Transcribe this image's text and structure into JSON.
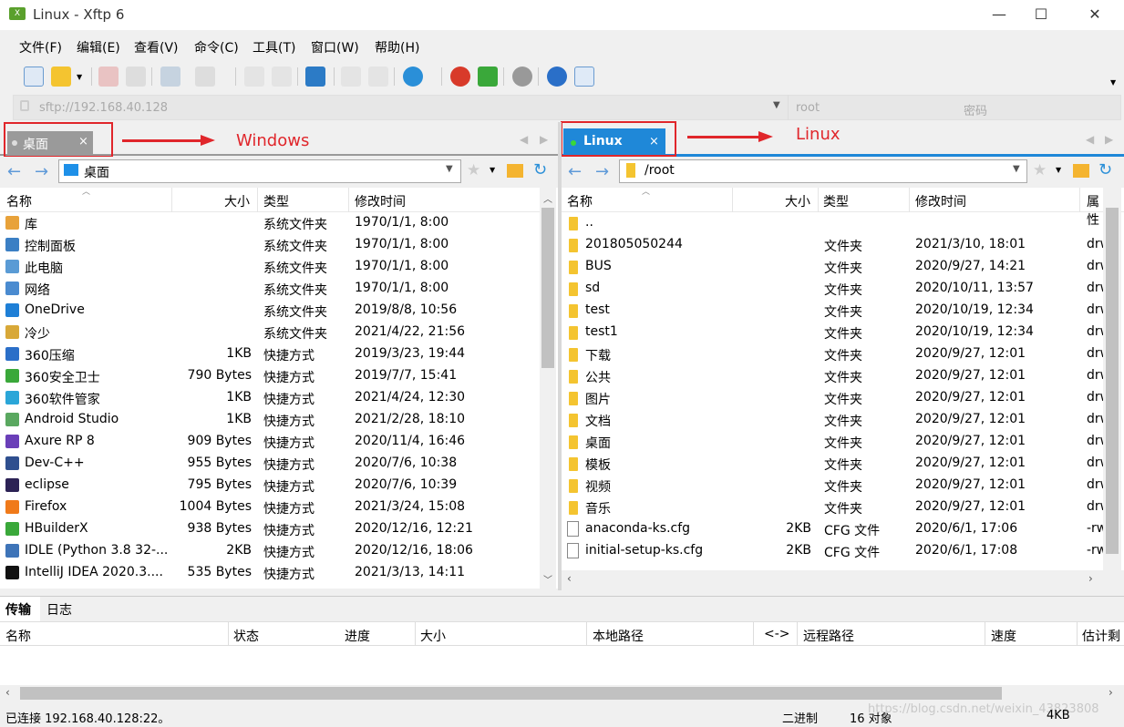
{
  "window": {
    "title": "Linux - Xftp 6",
    "app_icon": "X",
    "min": "—",
    "max": "☐",
    "close": "✕"
  },
  "menu": [
    "文件(F)",
    "编辑(E)",
    "查看(V)",
    "命令(C)",
    "工具(T)",
    "窗口(W)",
    "帮助(H)"
  ],
  "address": {
    "url": "sftp://192.168.40.128",
    "user_placeholder": "root",
    "password_placeholder": "密码"
  },
  "left": {
    "tab": "桌面",
    "tab_close": "×",
    "path": "桌面",
    "annotation": "Windows",
    "columns": [
      "名称",
      "大小",
      "类型",
      "修改时间"
    ],
    "rows": [
      {
        "name": "库",
        "size": "",
        "type": "系统文件夹",
        "mtime": "1970/1/1, 8:00",
        "color": "#e8a23a"
      },
      {
        "name": "控制面板",
        "size": "",
        "type": "系统文件夹",
        "mtime": "1970/1/1, 8:00",
        "color": "#3b7fc4"
      },
      {
        "name": "此电脑",
        "size": "",
        "type": "系统文件夹",
        "mtime": "1970/1/1, 8:00",
        "color": "#5a9bd5"
      },
      {
        "name": "网络",
        "size": "",
        "type": "系统文件夹",
        "mtime": "1970/1/1, 8:00",
        "color": "#4a8bd0"
      },
      {
        "name": "OneDrive",
        "size": "",
        "type": "系统文件夹",
        "mtime": "2019/8/8, 10:56",
        "color": "#1e7fd6"
      },
      {
        "name": "冷少",
        "size": "",
        "type": "系统文件夹",
        "mtime": "2021/4/22, 21:56",
        "color": "#d8a838"
      },
      {
        "name": "360压缩",
        "size": "1KB",
        "type": "快捷方式",
        "mtime": "2019/3/23, 19:44",
        "color": "#2b6fc8"
      },
      {
        "name": "360安全卫士",
        "size": "790 Bytes",
        "type": "快捷方式",
        "mtime": "2019/7/7, 15:41",
        "color": "#3aa83a"
      },
      {
        "name": "360软件管家",
        "size": "1KB",
        "type": "快捷方式",
        "mtime": "2021/4/24, 12:30",
        "color": "#2aa6d8"
      },
      {
        "name": "Android Studio",
        "size": "1KB",
        "type": "快捷方式",
        "mtime": "2021/2/28, 18:10",
        "color": "#5aa860"
      },
      {
        "name": "Axure RP 8",
        "size": "909 Bytes",
        "type": "快捷方式",
        "mtime": "2020/11/4, 16:46",
        "color": "#6a3fb8"
      },
      {
        "name": "Dev-C++",
        "size": "955 Bytes",
        "type": "快捷方式",
        "mtime": "2020/7/6, 10:38",
        "color": "#2f4f8f"
      },
      {
        "name": "eclipse",
        "size": "795 Bytes",
        "type": "快捷方式",
        "mtime": "2020/7/6, 10:39",
        "color": "#2c2255"
      },
      {
        "name": "Firefox",
        "size": "1004 Bytes",
        "type": "快捷方式",
        "mtime": "2021/3/24, 15:08",
        "color": "#f07a1a"
      },
      {
        "name": "HBuilderX",
        "size": "938 Bytes",
        "type": "快捷方式",
        "mtime": "2020/12/16, 12:21",
        "color": "#3aa83a"
      },
      {
        "name": "IDLE (Python 3.8 32-...",
        "size": "2KB",
        "type": "快捷方式",
        "mtime": "2020/12/16, 18:06",
        "color": "#3e74b8"
      },
      {
        "name": "IntelliJ IDEA 2020.3....",
        "size": "535 Bytes",
        "type": "快捷方式",
        "mtime": "2021/3/13, 14:11",
        "color": "#111111"
      }
    ]
  },
  "right": {
    "tab": "Linux",
    "tab_close": "×",
    "path": "/root",
    "annotation": "Linux",
    "columns": [
      "名称",
      "大小",
      "类型",
      "修改时间",
      "属性"
    ],
    "rows": [
      {
        "name": "..",
        "size": "",
        "type": "",
        "mtime": "",
        "attr": "",
        "kind": "folder"
      },
      {
        "name": "201805050244",
        "size": "",
        "type": "文件夹",
        "mtime": "2021/3/10, 18:01",
        "attr": "drw",
        "kind": "folder"
      },
      {
        "name": "BUS",
        "size": "",
        "type": "文件夹",
        "mtime": "2020/9/27, 14:21",
        "attr": "drw",
        "kind": "folder"
      },
      {
        "name": "sd",
        "size": "",
        "type": "文件夹",
        "mtime": "2020/10/11, 13:57",
        "attr": "drw",
        "kind": "folder"
      },
      {
        "name": "test",
        "size": "",
        "type": "文件夹",
        "mtime": "2020/10/19, 12:34",
        "attr": "drw",
        "kind": "folder"
      },
      {
        "name": "test1",
        "size": "",
        "type": "文件夹",
        "mtime": "2020/10/19, 12:34",
        "attr": "drw",
        "kind": "folder"
      },
      {
        "name": "下载",
        "size": "",
        "type": "文件夹",
        "mtime": "2020/9/27, 12:01",
        "attr": "drw",
        "kind": "folder"
      },
      {
        "name": "公共",
        "size": "",
        "type": "文件夹",
        "mtime": "2020/9/27, 12:01",
        "attr": "drw",
        "kind": "folder"
      },
      {
        "name": "图片",
        "size": "",
        "type": "文件夹",
        "mtime": "2020/9/27, 12:01",
        "attr": "drw",
        "kind": "folder"
      },
      {
        "name": "文档",
        "size": "",
        "type": "文件夹",
        "mtime": "2020/9/27, 12:01",
        "attr": "drw",
        "kind": "folder"
      },
      {
        "name": "桌面",
        "size": "",
        "type": "文件夹",
        "mtime": "2020/9/27, 12:01",
        "attr": "drw",
        "kind": "folder"
      },
      {
        "name": "模板",
        "size": "",
        "type": "文件夹",
        "mtime": "2020/9/27, 12:01",
        "attr": "drw",
        "kind": "folder"
      },
      {
        "name": "视频",
        "size": "",
        "type": "文件夹",
        "mtime": "2020/9/27, 12:01",
        "attr": "drw",
        "kind": "folder"
      },
      {
        "name": "音乐",
        "size": "",
        "type": "文件夹",
        "mtime": "2020/9/27, 12:01",
        "attr": "drw",
        "kind": "folder"
      },
      {
        "name": "anaconda-ks.cfg",
        "size": "2KB",
        "type": "CFG 文件",
        "mtime": "2020/6/1, 17:06",
        "attr": "-rw",
        "kind": "file"
      },
      {
        "name": "initial-setup-ks.cfg",
        "size": "2KB",
        "type": "CFG 文件",
        "mtime": "2020/6/1, 17:08",
        "attr": "-rw",
        "kind": "file"
      }
    ]
  },
  "bottom": {
    "tabs": [
      "传输",
      "日志"
    ],
    "columns": [
      "名称",
      "状态",
      "进度",
      "大小",
      "本地路径",
      "<->",
      "远程路径",
      "速度",
      "估计剩"
    ]
  },
  "status": {
    "connected": "已连接 192.168.40.128:22。",
    "mode": "二进制",
    "objects": "16 对象",
    "size": "4KB",
    "watermark": "https://blog.csdn.net/weixin_43823808"
  },
  "colors": {
    "accent": "#1f88d8",
    "annotation": "#e0262b"
  }
}
